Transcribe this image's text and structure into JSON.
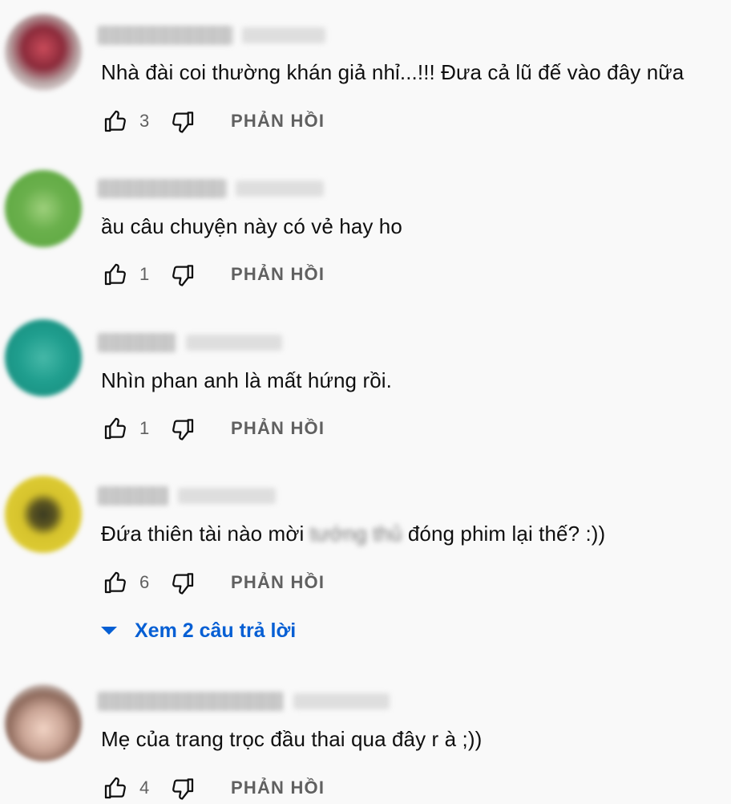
{
  "comments": [
    {
      "text": "Nhà đài coi thường khán giả nhỉ...!!! Đưa cả lũ đế vào đây nữa",
      "likes": "3",
      "reply_label": "PHẢN HỒI",
      "avatar_color": "#8b2a3a"
    },
    {
      "text": "ầu câu chuyện này có vẻ hay ho",
      "likes": "1",
      "reply_label": "PHẢN HỒI",
      "avatar_color": "#6ab04c"
    },
    {
      "text": "Nhìn phan anh là mất hứng rồi.",
      "likes": "1",
      "reply_label": "PHẢN HỒI",
      "avatar_color": "#1f9e8e"
    },
    {
      "text_before": "Đứa thiên tài nào mời ",
      "text_blurred": "tướng thủ",
      "text_after": " đóng phim lại thế? :))",
      "likes": "6",
      "reply_label": "PHẢN HỒI",
      "avatar_color": "#d6c32c",
      "view_replies": "Xem 2 câu trả lời"
    },
    {
      "text": "Mẹ của trang trọc đầu thai qua đây r à ;))",
      "likes": "4",
      "reply_label": "PHẢN HỒI",
      "avatar_color": "#caa596"
    }
  ],
  "colors": {
    "background": "#f9f9f9",
    "link_blue": "#065fd4",
    "muted": "#606060"
  },
  "icons": [
    "thumbs-up-icon",
    "thumbs-down-icon",
    "caret-down-icon"
  ]
}
